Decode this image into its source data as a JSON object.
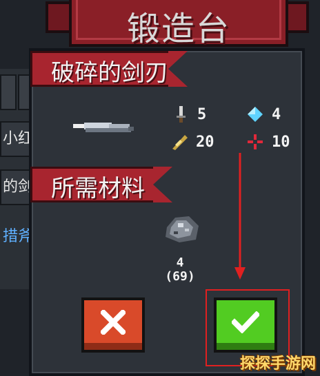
{
  "screen_title": "锻造台",
  "background_list": {
    "rows": [
      "小红",
      "的剑",
      "措斧"
    ]
  },
  "item": {
    "section_label": "破碎的剑刃",
    "stats": [
      {
        "icon": "sword-damage-icon",
        "value": "5"
      },
      {
        "icon": "diamond-crystal-icon",
        "value": "4"
      },
      {
        "icon": "feather-speed-icon",
        "value": "20"
      },
      {
        "icon": "crosshair-crit-icon",
        "value": "10"
      }
    ]
  },
  "materials": {
    "section_label": "所需材料",
    "required": "4",
    "owned": "(69)",
    "icon": "iron-ore-icon"
  },
  "buttons": {
    "cancel_icon": "x-icon",
    "confirm_icon": "checkmark-icon"
  },
  "annotation": {
    "highlight_color": "#e02020"
  },
  "watermark": "探探手游网",
  "colors": {
    "ribbon": "#a8252f",
    "panel": "#2d3239",
    "cancel": "#d94a2a",
    "confirm": "#52cc22"
  }
}
